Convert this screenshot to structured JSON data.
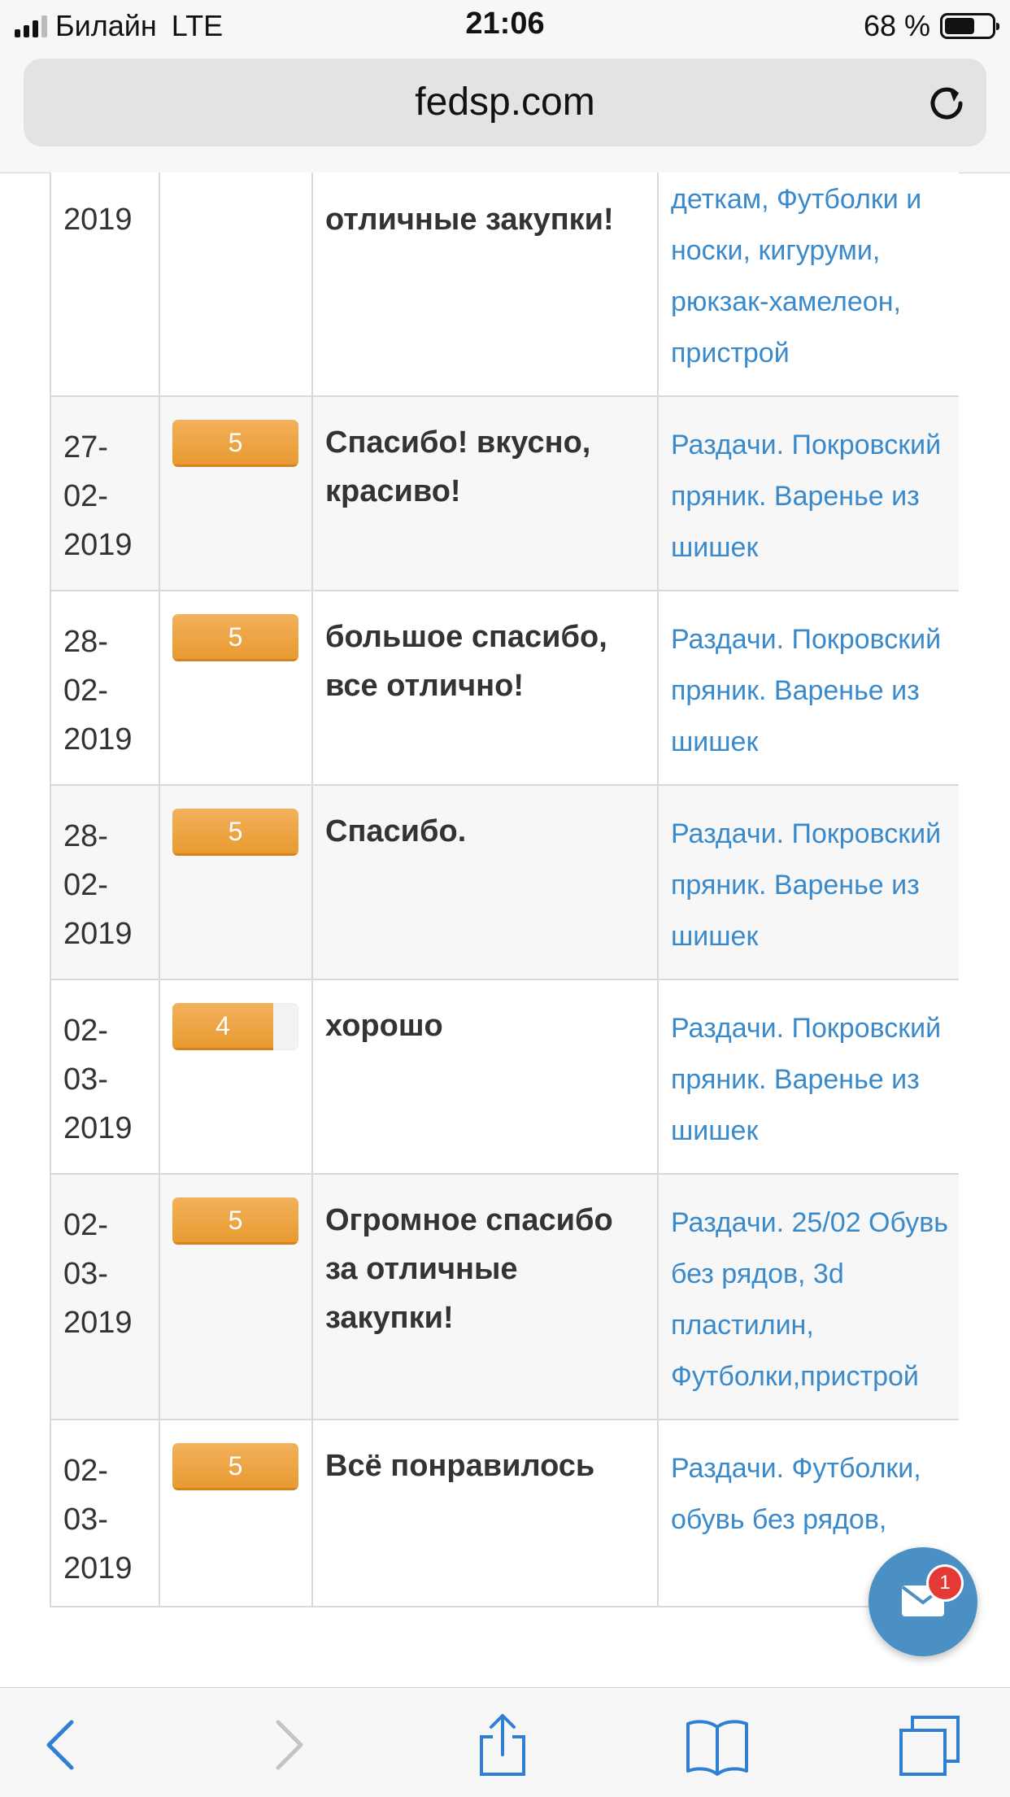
{
  "status_bar": {
    "carrier": "Билайн",
    "network": "LTE",
    "time": "21:06",
    "battery_text": "68 %",
    "battery_level": 0.68
  },
  "browser": {
    "url": "fedsp.com",
    "reload_icon": "reload-icon"
  },
  "rows": [
    {
      "date": "2019",
      "rating": null,
      "comment": "отличные закупки!",
      "links": "деткам, Футболки и носки, кигуруми, рюкзак-хамелеон, пристрой"
    },
    {
      "date": "27-02-2019",
      "rating": 5,
      "comment": "Спасибо! вкусно, красиво!",
      "links": "Раздачи. Покровский пряник. Варенье из шишек"
    },
    {
      "date": "28-02-2019",
      "rating": 5,
      "comment": "большое спасибо, все отлично!",
      "links": "Раздачи. Покровский пряник. Варенье из шишек"
    },
    {
      "date": "28-02-2019",
      "rating": 5,
      "comment": "Спасибо.",
      "links": "Раздачи. Покровский пряник. Варенье из шишек"
    },
    {
      "date": "02-03-2019",
      "rating": 4,
      "comment": "хорошо",
      "links": "Раздачи. Покровский пряник. Варенье из шишек"
    },
    {
      "date": "02-03-2019",
      "rating": 5,
      "comment": "Огромное спасибо за отличные закупки!",
      "links": "Раздачи. 25/02 Обувь без рядов, 3d пластилин, Футболки,пристрой"
    },
    {
      "date": "02-03-2019",
      "rating": 5,
      "comment": "Всё понравилось",
      "links": "Раздачи. Футболки, обувь без рядов,"
    }
  ],
  "rating_max": 5,
  "mail_button": {
    "icon": "envelope-icon",
    "badge": "1"
  },
  "toolbar": {
    "icons": [
      "back-icon",
      "forward-icon",
      "share-icon",
      "bookmarks-icon",
      "tabs-icon"
    ]
  },
  "colors": {
    "accent_orange": "#e99a31",
    "link_blue": "#3a8acb",
    "fab_blue": "#4a90c4",
    "badge_red": "#e53935"
  }
}
